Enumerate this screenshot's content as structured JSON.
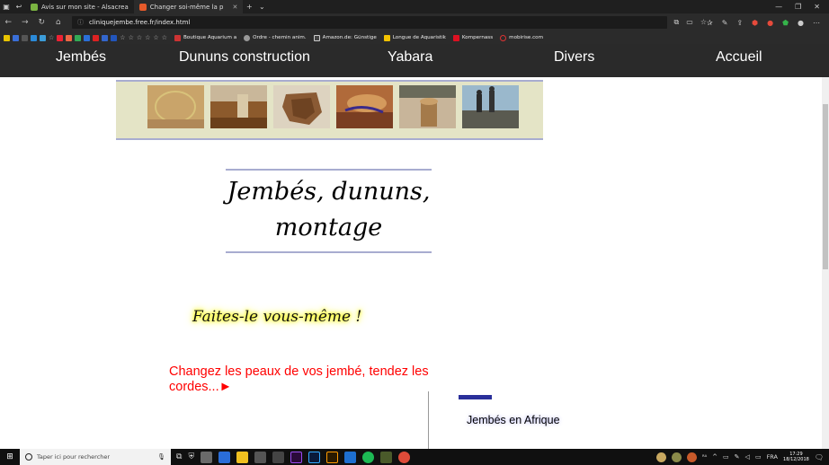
{
  "browser": {
    "tabs": [
      {
        "title": "Avis sur mon site - Alsacrea",
        "active": false
      },
      {
        "title": "Changer soi-même la p",
        "active": true
      }
    ],
    "new_tab_icon": "plus-icon",
    "url": "cliniquejembe.free.fr/index.html",
    "favorites": [
      "Boutique Aquarium a",
      "Ordre - chemin anim.",
      "Amazon.de: Günstige",
      "Longue de Aquaristik",
      "Kompernass",
      "mobirise.com"
    ]
  },
  "site": {
    "nav": [
      "Jembés",
      "Dununs construction",
      "Yabara",
      "Divers",
      "Accueil"
    ],
    "title_line1": "Jembés, dununs,",
    "title_line2": "montage",
    "tagline": "Faites-le vous-même !",
    "cta": "Changez les peaux de vos jembé, tendez les cordes...►",
    "side_link": "Jembés en Afrique"
  },
  "taskbar": {
    "search_placeholder": "Taper ici pour rechercher",
    "lang": "FRA",
    "time": "17:29",
    "date": "18/12/2018"
  },
  "colors": {
    "nav_bg": "#2a2a2a",
    "banner_bg": "#e4e4c6",
    "rule": "#a8acd0",
    "cta_red": "#ff0000",
    "glow": "#ffff00"
  }
}
